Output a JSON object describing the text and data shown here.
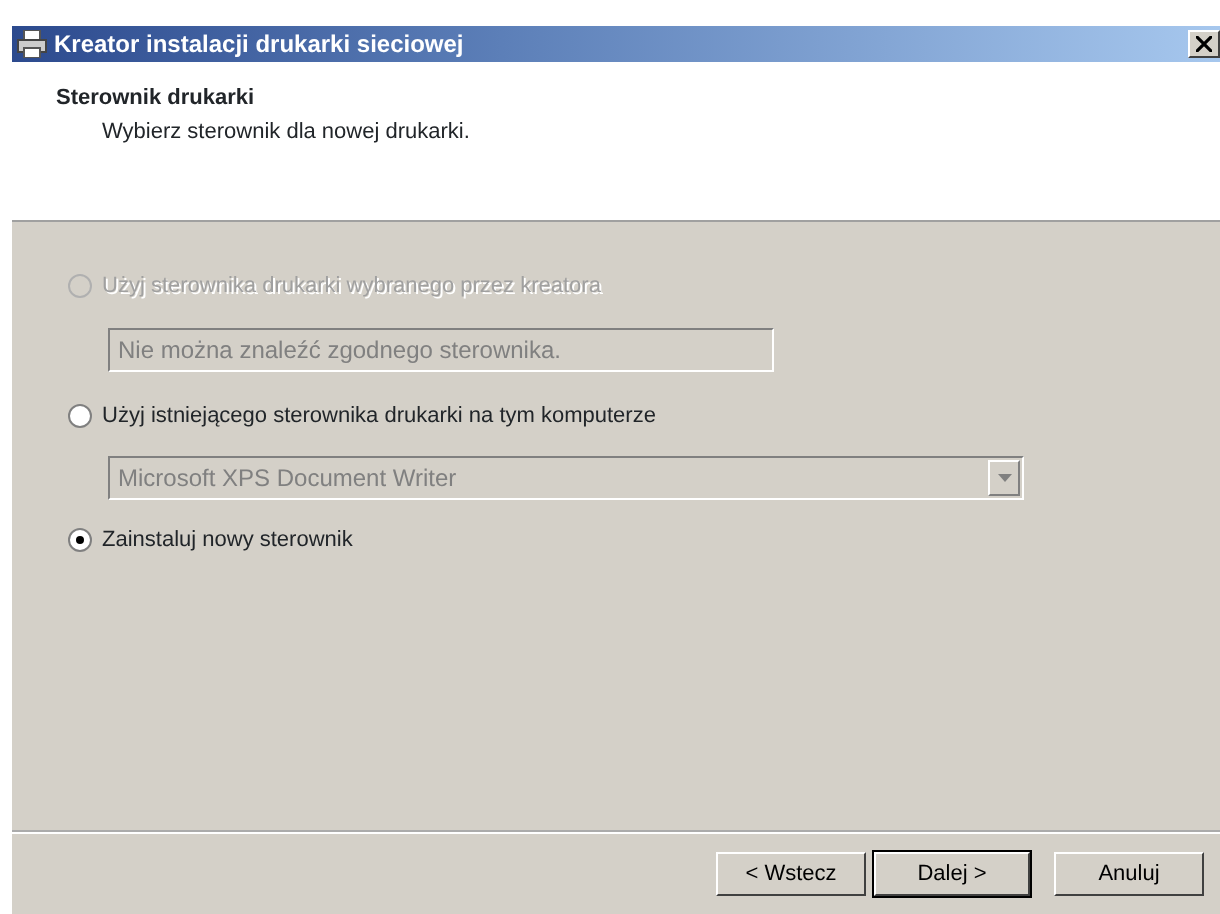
{
  "window": {
    "title": "Kreator instalacji drukarki sieciowej"
  },
  "header": {
    "title": "Sterownik drukarki",
    "subtitle": "Wybierz sterownik dla nowej drukarki."
  },
  "items": [
    {
      "kind": "radio",
      "label": "Użyj sterownika drukarki wybranego przez kreatora",
      "selected": false,
      "disabled": true
    },
    {
      "kind": "textbox",
      "value": "Nie można znaleźć zgodnego sterownika.",
      "disabled": true
    },
    {
      "kind": "radio",
      "label": "Użyj istniejącego sterownika drukarki na tym komputerze",
      "selected": false,
      "disabled": false
    },
    {
      "kind": "dropdown",
      "value": "Microsoft XPS Document Writer",
      "disabled": true
    },
    {
      "kind": "radio",
      "label": "Zainstaluj nowy sterownik",
      "selected": true,
      "disabled": false
    }
  ],
  "buttons": [
    {
      "label": "< Wstecz",
      "default": false
    },
    {
      "label": "Dalej >",
      "default": true
    },
    {
      "label": "Anuluj",
      "default": false
    }
  ]
}
